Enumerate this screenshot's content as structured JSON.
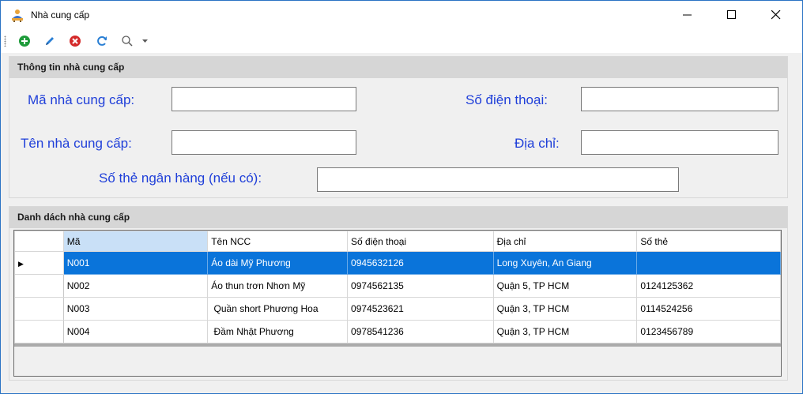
{
  "window": {
    "title": "Nhà cung cấp",
    "icon": "supplier-person-icon",
    "controls": [
      "minimize",
      "maximize",
      "close"
    ]
  },
  "toolbar": {
    "buttons": [
      {
        "icon": "add-icon",
        "color": "#1e9b3a"
      },
      {
        "icon": "edit-pencil-icon",
        "color": "#2a7fd4"
      },
      {
        "icon": "delete-icon",
        "color": "#d42a2a"
      },
      {
        "icon": "refresh-icon",
        "color": "#2a7fd4"
      },
      {
        "icon": "search-icon",
        "color": "#5a5a5a"
      },
      {
        "icon": "dropdown-arrow-icon",
        "color": "#5a5a5a"
      }
    ]
  },
  "info_group": {
    "title": "Thông tin nhà cung cấp",
    "ma_label": "Mã nhà cung cấp:",
    "ma_value": "",
    "ten_label": "Tên nhà cung cấp:",
    "ten_value": "",
    "sdt_label": "Số điện thoại:",
    "sdt_value": "",
    "diachi_label": "Địa chỉ:",
    "diachi_value": "",
    "sothe_label": "Số thẻ ngân hàng (nếu có):",
    "sothe_value": ""
  },
  "list_group": {
    "title": "Danh dách nhà cung cấp",
    "columns": [
      "Mã",
      "Tên NCC",
      "Số điện thoại",
      "Địa chỉ",
      "Số thẻ"
    ],
    "rows": [
      {
        "ma": "N001",
        "ten": "Áo dài Mỹ Phương",
        "sdt": "0945632126",
        "diachi": "Long Xuyên, An Giang",
        "sothe": ""
      },
      {
        "ma": "N002",
        "ten": "Áo thun trơn Nhơn Mỹ",
        "sdt": "0974562135",
        "diachi": "Quận 5, TP HCM",
        "sothe": "0124125362"
      },
      {
        "ma": "N003",
        "ten": " Quần short Phương Hoa",
        "sdt": "0974523621",
        "diachi": "Quận 3, TP HCM",
        "sothe": "0114524256"
      },
      {
        "ma": "N004",
        "ten": " Đầm Nhật Phương",
        "sdt": "0978541236",
        "diachi": "Quận 3, TP HCM",
        "sothe": "0123456789"
      }
    ],
    "selected_row": 0,
    "row_indicator": "▶"
  },
  "colors": {
    "label_blue": "#1f3fd9",
    "selection": "#0a74da",
    "header_selected": "#c9e0f7"
  }
}
